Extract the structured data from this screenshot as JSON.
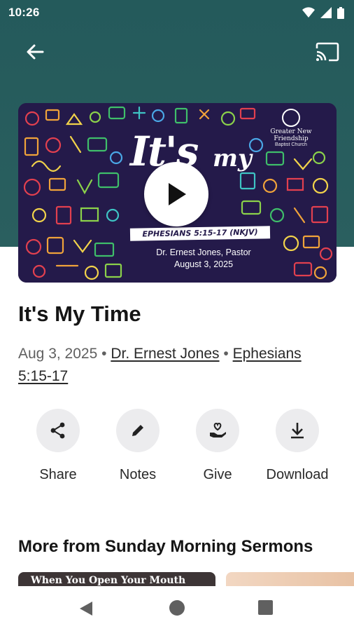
{
  "status_bar": {
    "time": "10:26"
  },
  "artwork": {
    "title_its": "It's",
    "title_my": "my",
    "scripture": "EPHESIANS 5:15-17 (NKJV)",
    "pastor_line": "Dr. Ernest Jones, Pastor",
    "date_line": "August 3, 2025",
    "church_name": "Greater New Friendship",
    "church_sub": "Baptist Church"
  },
  "sermon": {
    "title": "It's My Time",
    "date": "Aug 3, 2025",
    "separator": "•",
    "speaker": "Dr. Ernest Jones",
    "passage": "Ephesians 5:15-17"
  },
  "actions": [
    {
      "label": "Share",
      "icon": "share-icon"
    },
    {
      "label": "Notes",
      "icon": "pencil-icon"
    },
    {
      "label": "Give",
      "icon": "heart-hand-icon"
    },
    {
      "label": "Download",
      "icon": "download-icon"
    }
  ],
  "more_section": {
    "title": "More from Sunday Morning Sermons",
    "thumb1_text": "When You Open Your Mouth"
  },
  "colors": {
    "header": "#245a5b",
    "artwork_bg": "#241a4a"
  }
}
